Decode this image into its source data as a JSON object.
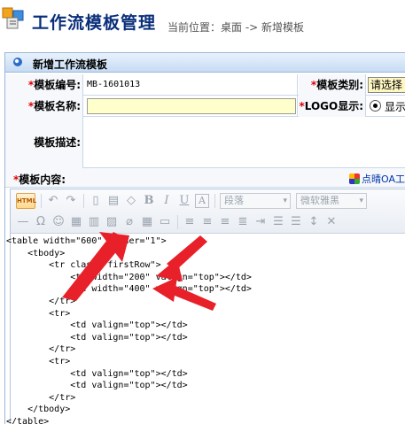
{
  "header": {
    "title": "工作流模板管理",
    "breadcrumb": "当前位置：桌面 -> 新增模板"
  },
  "panel": {
    "title": "新增工作流模板"
  },
  "form": {
    "code_label": "模板编号:",
    "code_value": "MB-1601013",
    "type_label": "模板类别:",
    "type_value": "请选择",
    "name_label": "模板名称:",
    "name_value": "",
    "logo_label": "LOGO显示:",
    "logo_option": "显示",
    "desc_label": "模板描述:",
    "content_label": "模板内容:",
    "oa_link": "点晴OA工"
  },
  "editor": {
    "html_button": "HTML",
    "paragraph_combo": "段落",
    "font_combo": "微软雅黑",
    "source_lines": [
      "<table width=\"600\" border=\"1\">",
      "    <tbody>",
      "        <tr class=\"firstRow\">",
      "            <td width=\"200\" valign=\"top\"></td>",
      "            <td width=\"400\" valign=\"top\"></td>",
      "        </tr>",
      "        <tr>",
      "            <td valign=\"top\"></td>",
      "            <td valign=\"top\"></td>",
      "        </tr>",
      "        <tr>",
      "            <td valign=\"top\"></td>",
      "            <td valign=\"top\"></td>",
      "        </tr>",
      "    </tbody>",
      "</table>"
    ]
  },
  "colors": {
    "title_blue": "#0a2f7a",
    "required_red": "#e00000",
    "arrow_red": "#e8202a",
    "name_field_bg": "#ffffcc"
  }
}
